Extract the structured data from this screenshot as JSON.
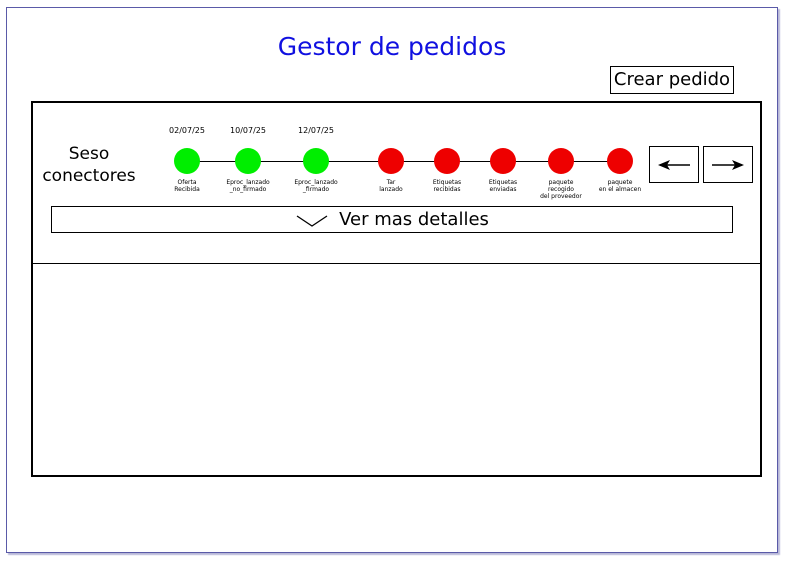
{
  "header": {
    "title": "Gestor de pedidos",
    "create_order_label": "Crear pedido",
    "title_color": "#1010e0"
  },
  "order": {
    "name": "Seso conectores",
    "steps": [
      {
        "label": "Oferta\nRecibida",
        "date": "02/07/25",
        "status": "done"
      },
      {
        "label": "Eproc_lanzado\n_no_firmado",
        "date": "10/07/25",
        "status": "done"
      },
      {
        "label": "Eproc_lanzado\n_firmado",
        "date": "12/07/25",
        "status": "done"
      },
      {
        "label": "Tar\nlanzado",
        "date": "",
        "status": "pending"
      },
      {
        "label": "Etiquetas\nrecibidas",
        "date": "",
        "status": "pending"
      },
      {
        "label": "Etiquetas\nenviadas",
        "date": "",
        "status": "pending"
      },
      {
        "label": "paquete\nrecogido\ndel proveedor",
        "date": "",
        "status": "pending"
      },
      {
        "label": "paquete\nen el almacen",
        "date": "",
        "status": "pending"
      }
    ],
    "prev_icon": "arrow-left-icon",
    "next_icon": "arrow-right-icon",
    "details_label": "Ver mas detalles",
    "details_icon": "chevron-down-icon",
    "colors": {
      "done": "#00ee00",
      "pending": "#ee0000"
    }
  }
}
